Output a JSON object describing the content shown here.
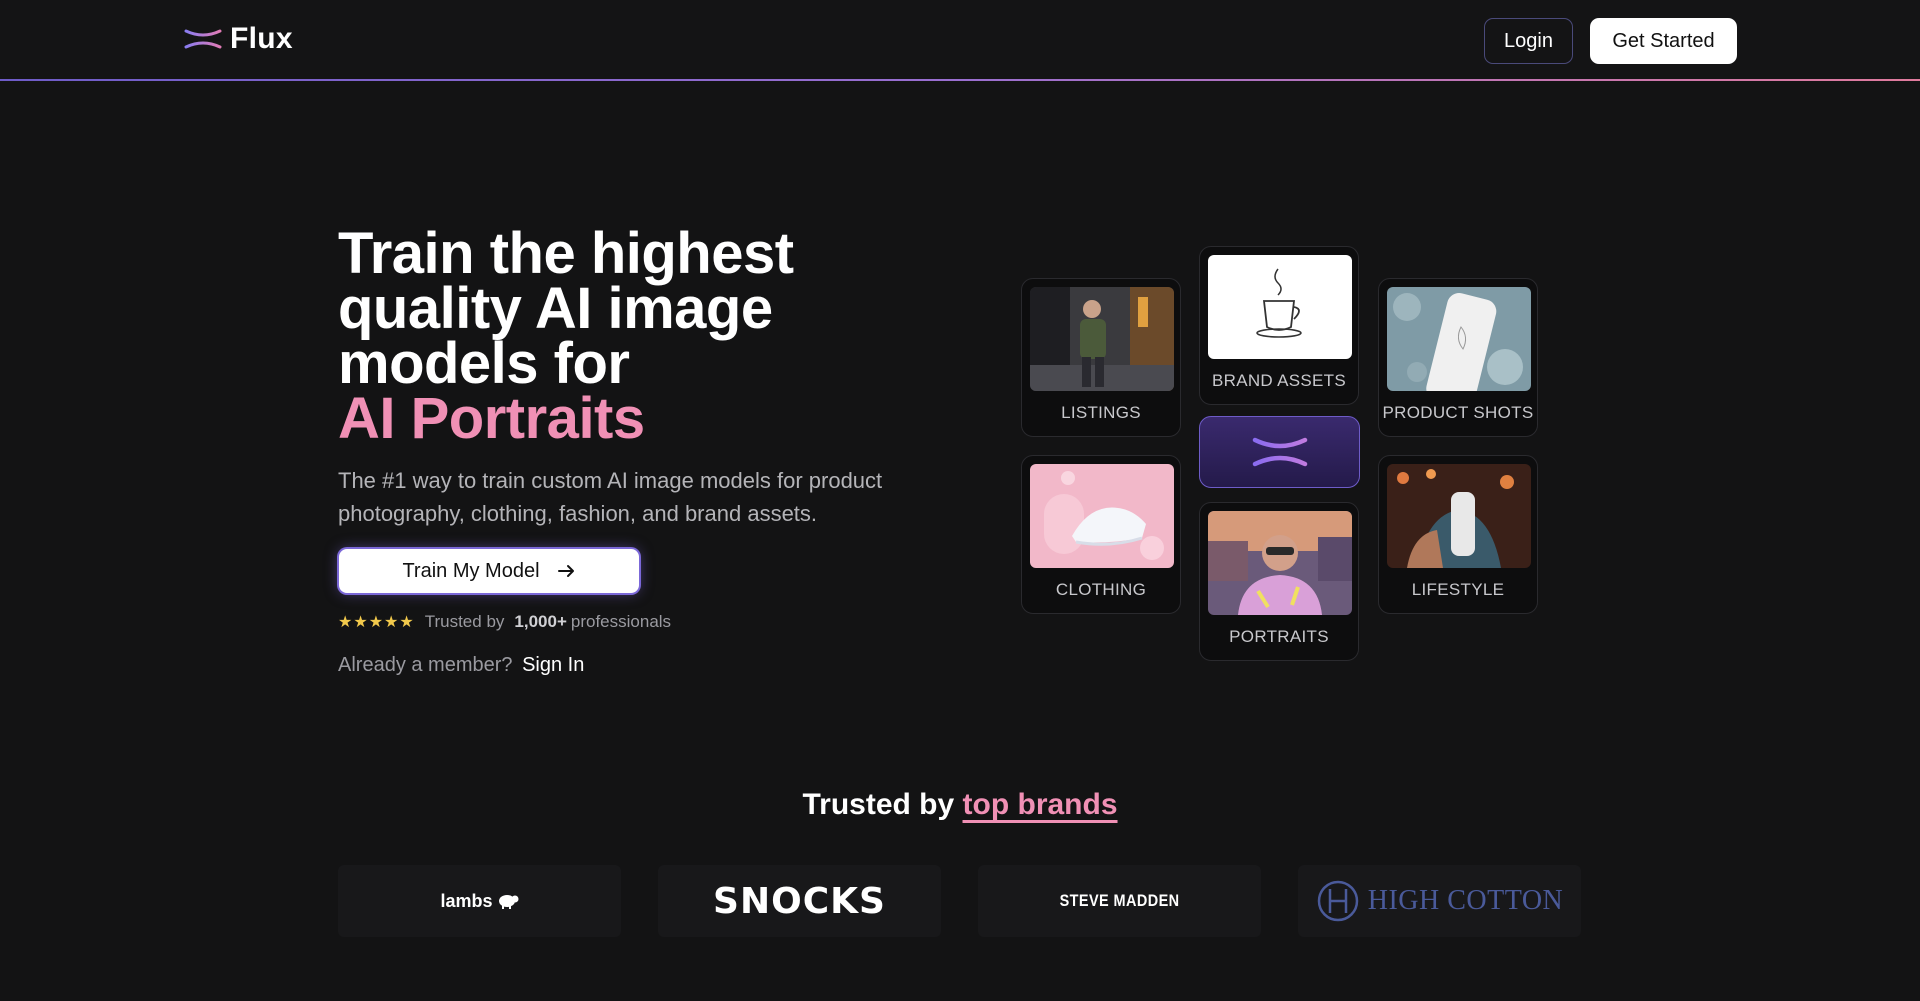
{
  "nav": {
    "logo_text": "Flux",
    "login_label": "Login",
    "get_started_label": "Get Started"
  },
  "hero": {
    "title": "Train the highest quality AI image models for",
    "title_accent": "AI Portraits",
    "subtitle": "The #1 way to train custom AI image models for product photography, clothing, fashion, and brand assets.",
    "cta_label": "Train My Model",
    "stars": "★★★★★",
    "trusted_prefix": "Trusted by",
    "trusted_count": "1,000+",
    "trusted_suffix": "professionals",
    "member_text": "Already a member?",
    "sign_in_label": "Sign In"
  },
  "categories": [
    {
      "label": "LISTINGS",
      "icon": "person-city-photo"
    },
    {
      "label": "BRAND ASSETS",
      "icon": "coffee-cup-sketch"
    },
    {
      "label": "PRODUCT SHOTS",
      "icon": "bottle-photo"
    },
    {
      "label": "CLOTHING",
      "icon": "sneaker-photo"
    },
    {
      "label": "PORTRAITS",
      "icon": "portrait-photo"
    },
    {
      "label": "LIFESTYLE",
      "icon": "bottle-lifestyle-photo"
    }
  ],
  "brands_section": {
    "title_prefix": "Trusted by",
    "title_accent": "top brands",
    "logos": [
      "Lambs",
      "SNOCKS",
      "STEVE MADDEN",
      "HIGH COTTON"
    ]
  },
  "colors": {
    "background": "#131314",
    "accent_pink": "#f090b5",
    "accent_purple": "#6e5cc8",
    "star_gold": "#f2c94c"
  }
}
